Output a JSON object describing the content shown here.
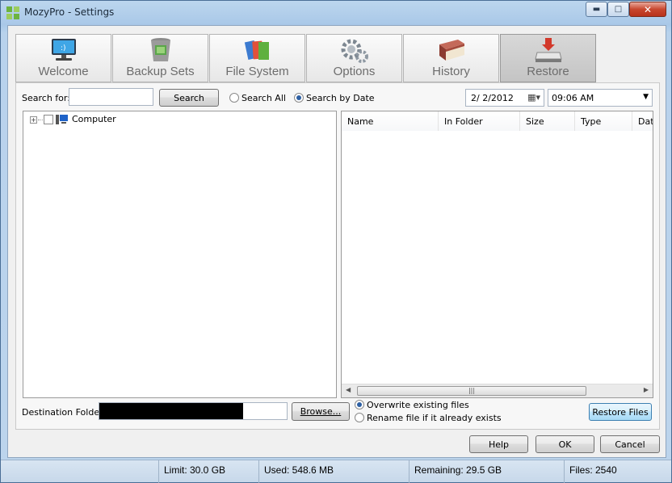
{
  "window": {
    "title": "MozyPro - Settings"
  },
  "tabs": [
    {
      "label": "Welcome",
      "icon": "monitor-icon"
    },
    {
      "label": "Backup Sets",
      "icon": "trash-can-icon"
    },
    {
      "label": "File System",
      "icon": "folders-icon"
    },
    {
      "label": "Options",
      "icon": "gears-icon"
    },
    {
      "label": "History",
      "icon": "book-icon"
    },
    {
      "label": "Restore",
      "icon": "restore-drive-icon",
      "active": true
    }
  ],
  "search": {
    "label": "Search for:",
    "value": "",
    "button": "Search",
    "mode_all": "Search All",
    "mode_date": "Search by Date",
    "date": "2/  2/2012",
    "time": "09:06 AM"
  },
  "tree": {
    "root_label": "Computer"
  },
  "list": {
    "columns": [
      "Name",
      "In Folder",
      "Size",
      "Type",
      "Dat"
    ]
  },
  "destination": {
    "label": "Destination Folder:",
    "browse": "Browse...",
    "overwrite": "Overwrite existing files",
    "rename": "Rename file if it already exists",
    "restore_button": "Restore Files"
  },
  "dialog_buttons": {
    "help": "Help",
    "ok": "OK",
    "cancel": "Cancel"
  },
  "status": {
    "limit": "Limit: 30.0 GB",
    "used": "Used: 548.6 MB",
    "remaining": "Remaining: 29.5 GB",
    "files": "Files: 2540"
  }
}
